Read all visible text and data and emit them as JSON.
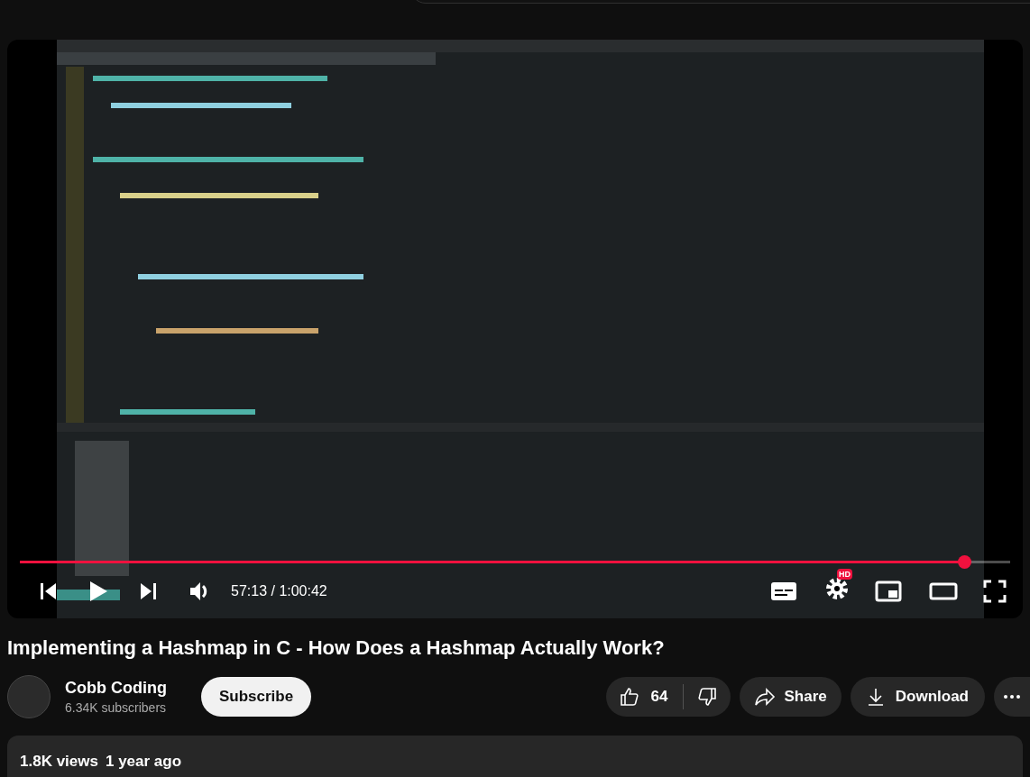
{
  "player": {
    "progress": {
      "level": 0.954
    },
    "time": "57:13 / 1:00:42",
    "settings_badge": "HD"
  },
  "video": {
    "title": "Implementing a Hashmap in C - How Does a Hashmap Actually Work?"
  },
  "channel": {
    "name": "Cobb Coding",
    "subscribers": "6.34K subscribers",
    "subscribe": "Subscribe"
  },
  "actions": {
    "likes": "64",
    "share": "Share",
    "download": "Download"
  },
  "description": {
    "views": "1.8K views",
    "age": "1 year ago"
  }
}
